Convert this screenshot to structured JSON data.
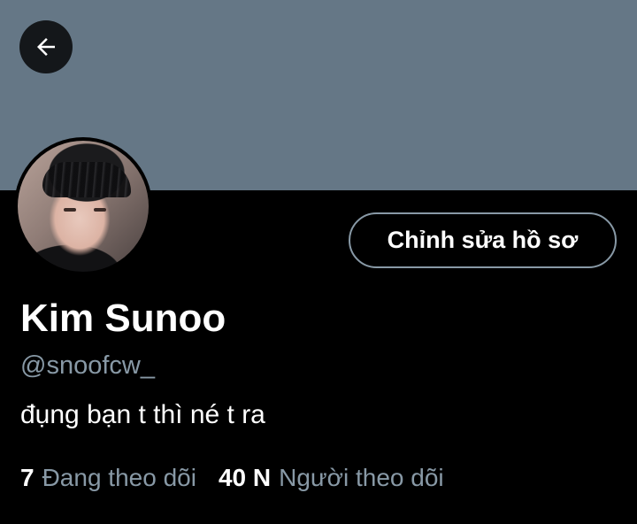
{
  "profile": {
    "name": "Kim Sunoo",
    "handle": "@snoofcw_",
    "bio": "đụng bạn t thì né t ra",
    "edit_button_label": "Chỉnh sửa hồ sơ"
  },
  "stats": {
    "following_count": "7",
    "following_label": "Đang theo dõi",
    "followers_count": "40 N",
    "followers_label": "Người theo dõi"
  },
  "icons": {
    "back": "arrow-left-icon"
  },
  "colors": {
    "banner": "#657786",
    "background": "#000000",
    "secondary_text": "#8899a6",
    "button_border": "#8899a6"
  }
}
